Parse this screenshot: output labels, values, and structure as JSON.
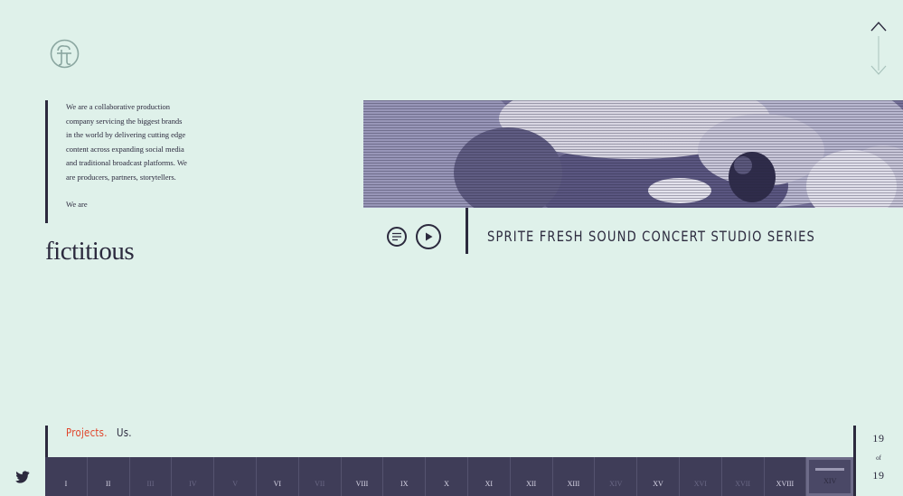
{
  "intro": {
    "text": "We are a collaborative production company servicing the biggest brands in the world by delivering cutting edge content across expanding social media and traditional broadcast platforms. We are producers, partners, storytellers.",
    "we_are": "We are"
  },
  "brand": {
    "wordmark": "fictitious"
  },
  "project": {
    "title": "SPRITE FRESH SOUND CONCERT STUDIO SERIES"
  },
  "nav": {
    "projects": "Projects.",
    "us": "Us."
  },
  "counter": {
    "current": "19",
    "of": "of",
    "total": "19"
  },
  "strip": {
    "items": [
      {
        "label": "I",
        "state": "on"
      },
      {
        "label": "II",
        "state": "on"
      },
      {
        "label": "III",
        "state": "off"
      },
      {
        "label": "IV",
        "state": "off"
      },
      {
        "label": "V",
        "state": "off"
      },
      {
        "label": "VI",
        "state": "on"
      },
      {
        "label": "VII",
        "state": "off"
      },
      {
        "label": "VIII",
        "state": "on"
      },
      {
        "label": "IX",
        "state": "on"
      },
      {
        "label": "X",
        "state": "on"
      },
      {
        "label": "XI",
        "state": "on"
      },
      {
        "label": "XII",
        "state": "on"
      },
      {
        "label": "XIII",
        "state": "on"
      },
      {
        "label": "XIV",
        "state": "off"
      },
      {
        "label": "XV",
        "state": "on"
      },
      {
        "label": "XVI",
        "state": "off"
      },
      {
        "label": "XVII",
        "state": "off"
      },
      {
        "label": "XVIII",
        "state": "on"
      },
      {
        "label": "XIV",
        "state": "active"
      }
    ]
  },
  "colors": {
    "accent": "#e0452b",
    "background": "#dff1ea",
    "ink": "#2c2a3e",
    "strip": "#3f3d58"
  },
  "icons": [
    "logo-icon",
    "list-icon",
    "play-icon",
    "arrow-up-icon",
    "arrow-down-icon",
    "twitter-icon"
  ]
}
